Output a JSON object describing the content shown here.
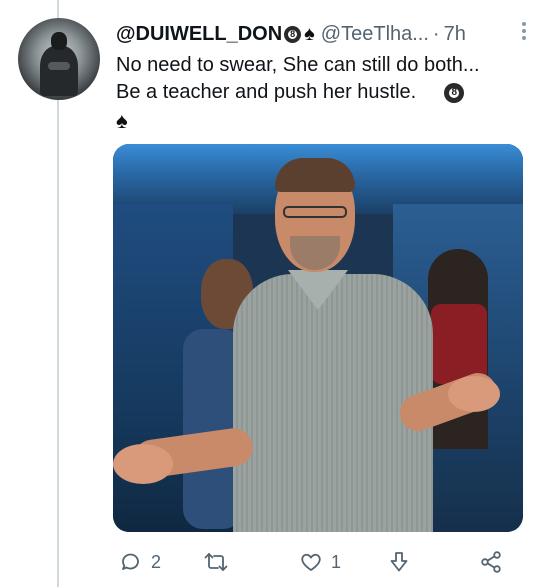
{
  "tweet": {
    "display_name": "@DUIWELL_DON",
    "badge_eight": "8",
    "badge_spade": "♠",
    "handle": "@TeeTlha...",
    "separator": "·",
    "time": "7h",
    "lines": [
      "No need to swear, She can still do both...",
      "Be a teacher and push her hustle."
    ],
    "trailing_spade": "♠"
  },
  "actions": {
    "reply_count": "2",
    "like_count": "1"
  },
  "colors": {
    "secondary_text": "#536471",
    "thread_line": "#cfd9de"
  },
  "icons": [
    "reply-icon",
    "retweet-icon",
    "like-icon",
    "download-icon",
    "share-icon",
    "more-icon"
  ]
}
